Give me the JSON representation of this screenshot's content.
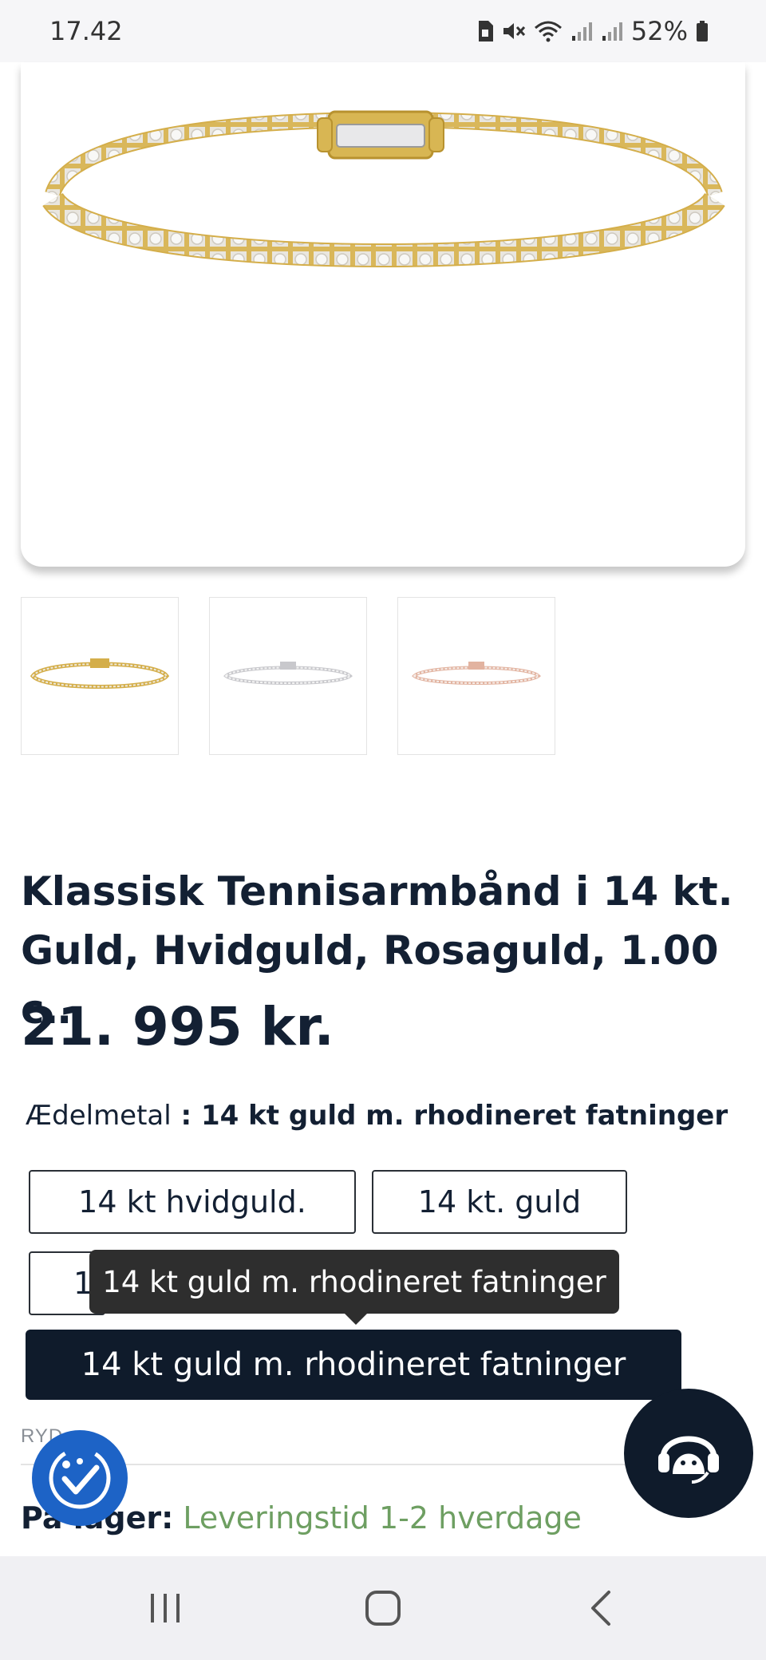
{
  "status_bar": {
    "time": "17.42",
    "battery": "52%"
  },
  "product": {
    "title": "Klassisk Tennisarmbånd i 14 kt. Guld, Hvidguld, Rosaguld, 1.00 c…",
    "price": "21. 995 kr.",
    "thumbnails": [
      "yellow-gold-bracelet",
      "white-gold-bracelet",
      "rose-gold-bracelet"
    ]
  },
  "metal": {
    "label": "Ædelmetal",
    "separator": " : ",
    "value": "14 kt guld m. rhodineret fatninger",
    "options": [
      {
        "label": "14 kt hvidguld."
      },
      {
        "label": "14 kt. guld"
      },
      {
        "label": "14 kt rosaguld."
      },
      {
        "label": "14 kt guld m. rhodineret fatninger",
        "selected": true
      }
    ],
    "partial_visible": "1",
    "tooltip": "14 kt guld m. rhodineret fatninger"
  },
  "reset": {
    "label": "RYD"
  },
  "delivery": {
    "label": "På lager:",
    "value": "Leveringstid 1-2 hverdage"
  },
  "colors": {
    "navy": "#0f1b2b",
    "delivery_green": "#6e9f62",
    "accessibility_blue": "#1d63c6"
  }
}
